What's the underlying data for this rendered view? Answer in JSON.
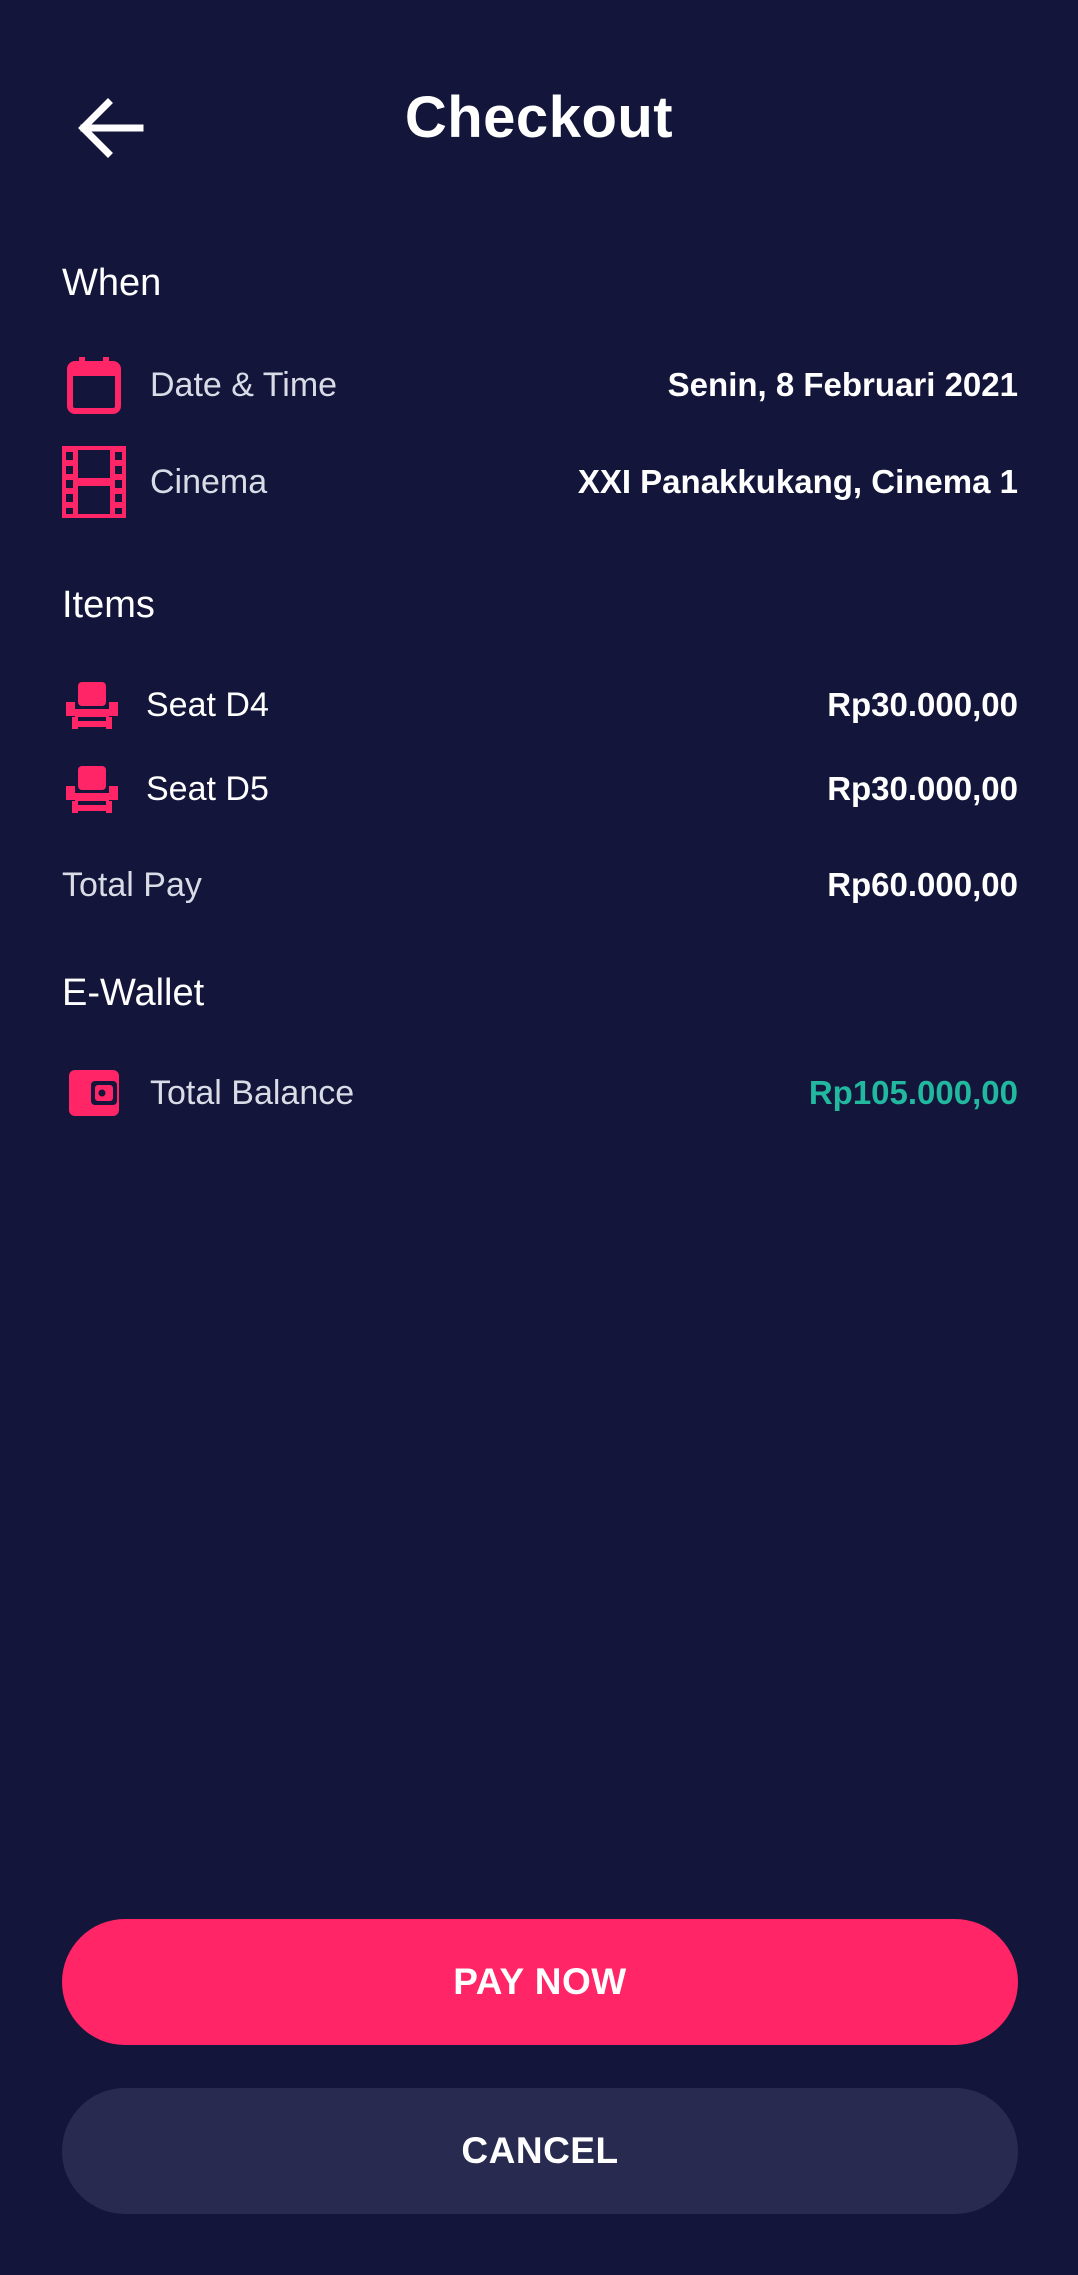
{
  "header": {
    "title": "Checkout",
    "back_icon": "arrow-left-icon"
  },
  "when": {
    "title": "When",
    "date": {
      "icon": "calendar-icon",
      "label": "Date & Time",
      "value": "Senin, 8 Februari 2021"
    },
    "cinema": {
      "icon": "film-icon",
      "label": "Cinema",
      "value": "XXI Panakkukang, Cinema 1"
    }
  },
  "items": {
    "title": "Items",
    "seats": [
      {
        "icon": "seat-icon",
        "label": "Seat D4",
        "value": "Rp30.000,00"
      },
      {
        "icon": "seat-icon",
        "label": "Seat D5",
        "value": "Rp30.000,00"
      }
    ],
    "total_label": "Total Pay",
    "total_value": "Rp60.000,00"
  },
  "wallet": {
    "title": "E-Wallet",
    "icon": "wallet-icon",
    "label": "Total Balance",
    "value": "Rp105.000,00"
  },
  "actions": {
    "pay_label": "PAY NOW",
    "cancel_label": "CANCEL"
  },
  "colors": {
    "background": "#13163a",
    "accent": "#ff2566",
    "balance": "#22b8a0",
    "secondary_button": "#282a50"
  }
}
